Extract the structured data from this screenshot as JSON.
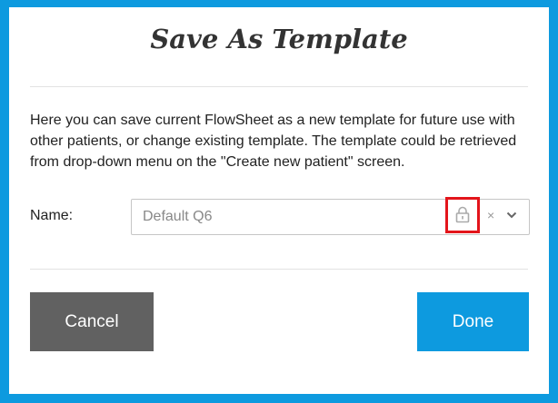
{
  "dialog": {
    "title": "Save As Template",
    "description": "Here you can save current FlowSheet as a new template for future use with other patients, or change existing template. The template could be retrieved from drop-down menu on the \"Create new patient\" screen.",
    "name_label": "Name:",
    "name_select": {
      "value": "Default Q6",
      "icons": [
        "lock-icon",
        "clear-icon",
        "chevron-down-icon"
      ],
      "clear_glyph": "×"
    },
    "buttons": {
      "cancel_label": "Cancel",
      "done_label": "Done"
    }
  },
  "colors": {
    "frame_border": "#0d9adf",
    "done_button": "#0d9adf",
    "cancel_button": "#616161",
    "highlight_box": "#e3151b"
  }
}
